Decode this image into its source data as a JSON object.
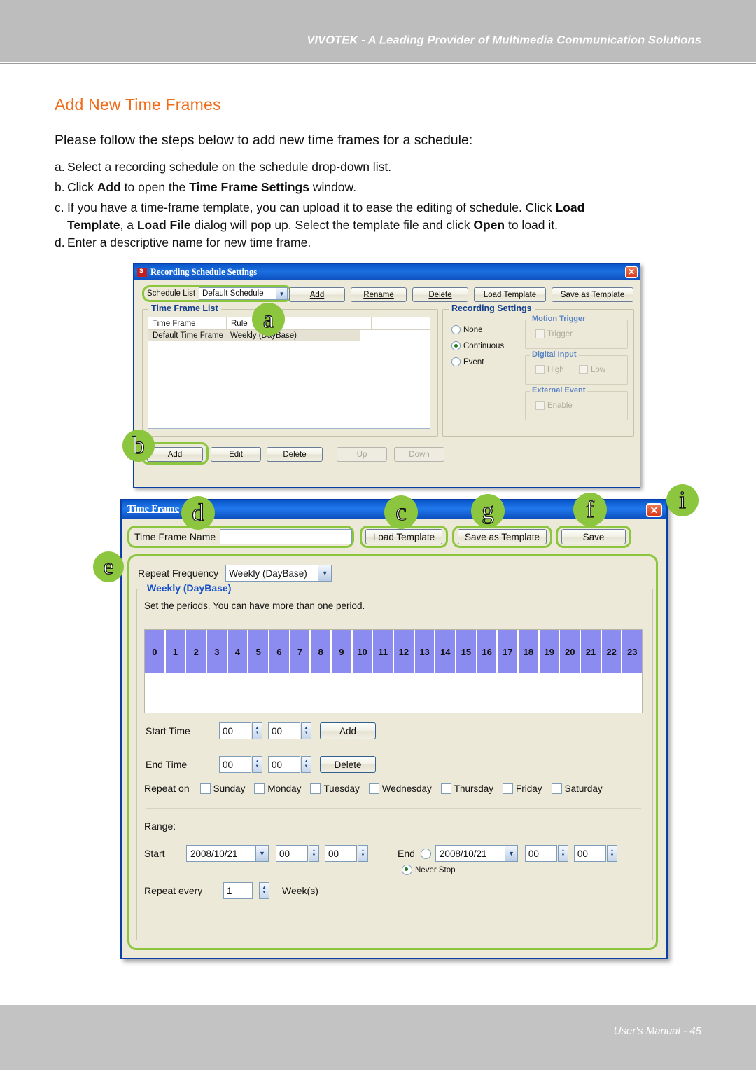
{
  "page": {
    "header_title": "VIVOTEK - A Leading Provider of Multimedia Communication Solutions",
    "footer_text": "User's Manual - 45",
    "heading": "Add New Time Frames",
    "intro": "Please follow the steps below to add new time frames for a schedule:",
    "accent_orange": "#ef6c1a",
    "callout_green": "#8cc63f"
  },
  "steps": {
    "a_marker": "a.",
    "a_text": "Select a recording schedule on the schedule drop-down list.",
    "b_marker": "b.",
    "b_pre": "Click ",
    "b_bold1": "Add",
    "b_mid": " to open the ",
    "b_bold2": "Time Frame Settings",
    "b_post": " window.",
    "c_marker": "c.",
    "c_line1_pre": "If you have a time-frame template, you can upload it to ease the editing of schedule. Click ",
    "c_bold1": "Load",
    "c_line2_bold": "Template",
    "c_line2_mid1": ", a ",
    "c_bold2": "Load File",
    "c_line2_mid2": " dialog will pop up. Select the template file and click ",
    "c_bold3": "Open",
    "c_line2_end": " to load it.",
    "d_marker": "d.",
    "d_text": "Enter a descriptive name for new time frame."
  },
  "window1": {
    "title": "Recording Schedule Settings",
    "close_label": "✕",
    "schedule_label": "Schedule List",
    "schedule_value": "Default Schedule",
    "toolbar": {
      "add": "Add",
      "rename": "Rename",
      "delete": "Delete",
      "load_template": "Load Template",
      "save_as_template": "Save as Template"
    },
    "group_title": "Time Frame List",
    "columns": [
      "Time Frame",
      "Rule",
      ""
    ],
    "rows": [
      {
        "time_frame": "Default Time Frame",
        "rule": "Weekly (DayBase)"
      }
    ],
    "recording_settings": {
      "title": "Recording Settings",
      "modes": [
        {
          "label": "None",
          "selected": false
        },
        {
          "label": "Continuous",
          "selected": true
        },
        {
          "label": "Event",
          "selected": false
        }
      ],
      "motion_trigger": {
        "title": "Motion Trigger",
        "items": [
          "Trigger"
        ]
      },
      "digital_input": {
        "title": "Digital Input",
        "items": [
          "High",
          "Low"
        ]
      },
      "external_event": {
        "title": "External Event",
        "items": [
          "Enable"
        ]
      }
    },
    "bottom_buttons": {
      "add": "Add",
      "edit": "Edit",
      "delete": "Delete",
      "up": "Up",
      "down": "Down"
    }
  },
  "window2": {
    "title": "Time Frame",
    "close_label": "✕",
    "name_label": "Time Frame Name",
    "name_value": "",
    "buttons": {
      "load_template": "Load Template",
      "save_as_template": "Save as Template",
      "save": "Save"
    },
    "repeat_frequency_label": "Repeat Frequency",
    "repeat_frequency_value": "Weekly (DayBase)",
    "weekly_title": "Weekly (DayBase)",
    "weekly_note": "Set the periods. You can have more than one period.",
    "hours": [
      "0",
      "1",
      "2",
      "3",
      "4",
      "5",
      "6",
      "7",
      "8",
      "9",
      "10",
      "11",
      "12",
      "13",
      "14",
      "15",
      "16",
      "17",
      "18",
      "19",
      "20",
      "21",
      "22",
      "23"
    ],
    "start_time_label": "Start Time",
    "start_time_hour": "00",
    "start_time_minute": "00",
    "add_button": "Add",
    "end_time_label": "End Time",
    "end_time_hour": "00",
    "end_time_minute": "00",
    "delete_button": "Delete",
    "repeat_on_label": "Repeat on",
    "days": [
      "Sunday",
      "Monday",
      "Tuesday",
      "Wednesday",
      "Thursday",
      "Friday",
      "Saturday"
    ],
    "range_label": "Range:",
    "start_label": "Start",
    "start_date": "2008/10/21",
    "start_hour": "00",
    "start_minute": "00",
    "end_label": "End",
    "end_date": "2008/10/21",
    "end_hour": "00",
    "end_minute": "00",
    "never_stop_label": "Never Stop",
    "never_stop_selected": true,
    "repeat_every_label": "Repeat every",
    "repeat_every_value": "1",
    "repeat_every_unit": "Week(s)"
  },
  "callouts": [
    {
      "id": "a",
      "label": "a"
    },
    {
      "id": "b",
      "label": "b"
    },
    {
      "id": "c",
      "label": "c"
    },
    {
      "id": "d",
      "label": "d"
    },
    {
      "id": "e",
      "label": "e"
    },
    {
      "id": "f",
      "label": "f"
    },
    {
      "id": "g",
      "label": "g"
    },
    {
      "id": "i",
      "label": "i"
    }
  ]
}
